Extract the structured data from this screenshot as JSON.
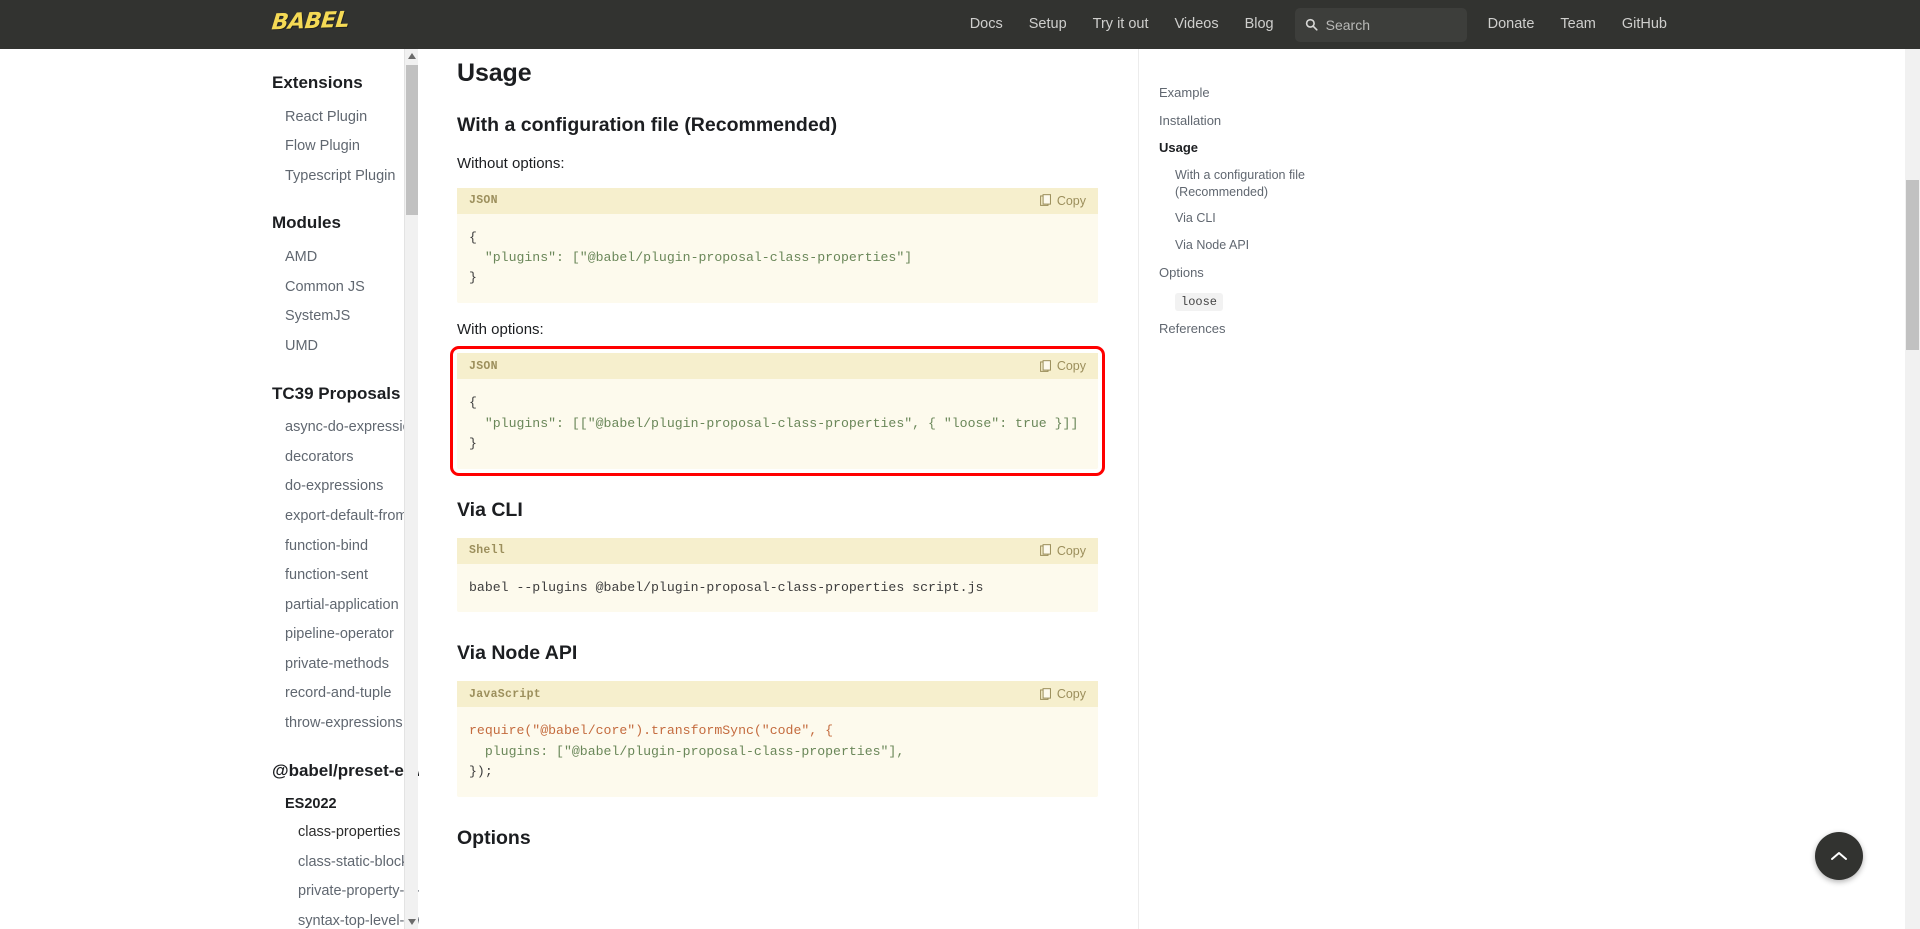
{
  "navbar": {
    "logo": "BABEL",
    "links": [
      "Docs",
      "Setup",
      "Try it out",
      "Videos",
      "Blog"
    ],
    "right_links": [
      "Donate",
      "Team",
      "GitHub"
    ],
    "search_placeholder": "Search",
    "bg_color": "#323330",
    "logo_color": "#f5da55"
  },
  "sidebar": {
    "groups": [
      {
        "title": "Extensions",
        "items": [
          {
            "label": "React Plugin",
            "level": 1,
            "active": false
          },
          {
            "label": "Flow Plugin",
            "level": 1,
            "active": false
          },
          {
            "label": "Typescript Plugin",
            "level": 1,
            "active": false
          }
        ]
      },
      {
        "title": "Modules",
        "items": [
          {
            "label": "AMD",
            "level": 1,
            "active": false
          },
          {
            "label": "Common JS",
            "level": 1,
            "active": false
          },
          {
            "label": "SystemJS",
            "level": 1,
            "active": false
          },
          {
            "label": "UMD",
            "level": 1,
            "active": false
          }
        ]
      },
      {
        "title": "TC39 Proposals",
        "items": [
          {
            "label": "async-do-expressions",
            "level": 1,
            "active": false
          },
          {
            "label": "decorators",
            "level": 1,
            "active": false
          },
          {
            "label": "do-expressions",
            "level": 1,
            "active": false
          },
          {
            "label": "export-default-from",
            "level": 1,
            "active": false
          },
          {
            "label": "function-bind",
            "level": 1,
            "active": false
          },
          {
            "label": "function-sent",
            "level": 1,
            "active": false
          },
          {
            "label": "partial-application",
            "level": 1,
            "active": false
          },
          {
            "label": "pipeline-operator",
            "level": 1,
            "active": false
          },
          {
            "label": "private-methods",
            "level": 1,
            "active": false
          },
          {
            "label": "record-and-tuple",
            "level": 1,
            "active": false
          },
          {
            "label": "throw-expressions",
            "level": 1,
            "active": false
          }
        ]
      },
      {
        "title": "@babel/preset-env",
        "subtitle": "ES2022",
        "items": [
          {
            "label": "class-properties",
            "level": 2,
            "active": true
          },
          {
            "label": "class-static-block",
            "level": 2,
            "active": false
          },
          {
            "label": "private-property-in-object",
            "level": 2,
            "active": false
          },
          {
            "label": "syntax-top-level-await",
            "level": 2,
            "active": false
          }
        ]
      }
    ]
  },
  "main": {
    "title": "Usage",
    "sections": [
      {
        "heading": "With a configuration file (Recommended)",
        "lead_1": "Without options:",
        "lead_2": "With options:"
      }
    ],
    "code_without_options": {
      "lang": "JSON",
      "copy_label": "Copy",
      "lines": [
        "{",
        "  \"plugins\": [\"@babel/plugin-proposal-class-properties\"]",
        "}"
      ]
    },
    "code_with_options": {
      "lang": "JSON",
      "copy_label": "Copy",
      "highlighted": true,
      "highlight_color": "#ff0000",
      "lines": [
        "{",
        "  \"plugins\": [[\"@babel/plugin-proposal-class-properties\", { \"loose\": true }]]",
        "}"
      ]
    },
    "via_cli": {
      "heading": "Via CLI",
      "lang": "Shell",
      "copy_label": "Copy",
      "code": "babel --plugins @babel/plugin-proposal-class-properties script.js"
    },
    "via_node_api": {
      "heading": "Via Node API",
      "lang": "JavaScript",
      "copy_label": "Copy",
      "lines": [
        "require(\"@babel/core\").transformSync(\"code\", {",
        "  plugins: [\"@babel/plugin-proposal-class-properties\"],",
        "});"
      ]
    },
    "options_heading": "Options"
  },
  "toc": {
    "items": [
      {
        "label": "Example",
        "level": 0,
        "active": false,
        "code": false
      },
      {
        "label": "Installation",
        "level": 0,
        "active": false,
        "code": false
      },
      {
        "label": "Usage",
        "level": 0,
        "active": true,
        "code": false
      },
      {
        "label": "With a configuration file (Recommended)",
        "level": 1,
        "active": false,
        "code": false
      },
      {
        "label": "Via CLI",
        "level": 1,
        "active": false,
        "code": false
      },
      {
        "label": "Via Node API",
        "level": 1,
        "active": false,
        "code": false
      },
      {
        "label": "Options",
        "level": 0,
        "active": false,
        "code": false
      },
      {
        "label": "loose",
        "level": 1,
        "active": false,
        "code": true
      },
      {
        "label": "References",
        "level": 0,
        "active": false,
        "code": false
      }
    ]
  },
  "fab": {
    "name": "scroll-to-top"
  }
}
